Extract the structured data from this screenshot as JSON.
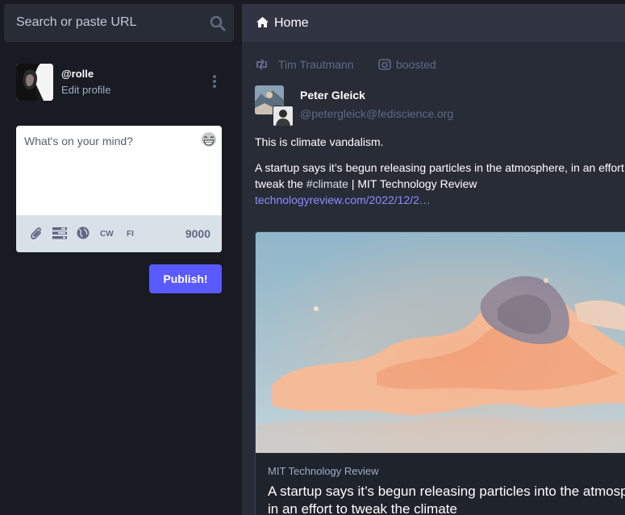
{
  "search": {
    "placeholder": "Search or paste URL",
    "icon": "search-icon"
  },
  "account": {
    "handle": "@rolle",
    "edit_label": "Edit profile"
  },
  "compose": {
    "placeholder": "What's on your mind?",
    "cw_label": "CW",
    "fi_label": "FI",
    "char_count": "9000",
    "publish_label": "Publish!"
  },
  "column": {
    "title": "Home"
  },
  "status": {
    "booster_name": "Tim Trautmann",
    "boosted_label": "boosted",
    "author_name": "Peter Gleick",
    "author_acct": "@petergleick@fediscience.org",
    "paragraph1": "This is climate vandalism.",
    "paragraph2_line1": "A startup says it’s begun releasing particles in the atmosphere, in an effort to",
    "paragraph2_pre_tag": "tweak the ",
    "hashtag": "#climate",
    "paragraph2_post_tag": " | MIT Technology Review",
    "link_text": "technologyreview.com/2022/12/2…",
    "card_provider": "MIT Technology Review",
    "card_title_line1": "A startup says it’s begun releasing particles into the atmosphere,",
    "card_title_line2": "in an effort to tweak the climate"
  },
  "colors": {
    "background": "#191b22",
    "panel": "#282c37",
    "accent": "#595aff",
    "link": "#8c8dff"
  }
}
